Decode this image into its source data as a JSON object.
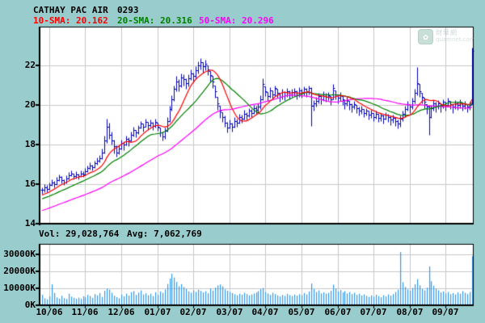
{
  "header": {
    "title": "CATHAY PAC AIR",
    "code": "0293"
  },
  "legend": [
    {
      "text": "10-SMA: 20.162",
      "color": "#ff0000"
    },
    {
      "text": "20-SMA: 20.316",
      "color": "#008000"
    },
    {
      "text": "50-SMA: 20.296",
      "color": "#ff00ff"
    }
  ],
  "volume_header": {
    "vol": "Vol: 29,028,764",
    "avg": "Avg: 7,062,769"
  },
  "watermark": {
    "name": "財華網",
    "domain": "quamnet.com"
  },
  "chart_data": {
    "type": "ohlc_bars_with_volume",
    "title": "CATHAY PAC AIR 0293 daily price with 10/20/50-day SMA and volume",
    "x_axis": {
      "labels": [
        "10/06",
        "11/06",
        "12/06",
        "01/07",
        "02/07",
        "03/07",
        "04/07",
        "05/07",
        "06/07",
        "07/07",
        "08/07",
        "09/07"
      ]
    },
    "price_axis": {
      "ticks": [
        {
          "label": "22",
          "value": 22
        },
        {
          "label": "20",
          "value": 20
        },
        {
          "label": "18",
          "value": 18
        },
        {
          "label": "16",
          "value": 16
        },
        {
          "label": "14",
          "value": 14
        }
      ],
      "ylim": [
        14,
        23.96
      ]
    },
    "volume_axis": {
      "ticks": [
        {
          "label": "30000K",
          "value_k": 30000
        },
        {
          "label": "20000K",
          "value_k": 20000
        },
        {
          "label": "10000K",
          "value_k": 10000
        },
        {
          "label": "0K",
          "value_k": 0
        }
      ],
      "ylim_k": [
        0,
        36500
      ]
    },
    "sma_series": [
      {
        "name": "10-SMA",
        "period": 10,
        "last": 20.162,
        "color": "#ff0000"
      },
      {
        "name": "20-SMA",
        "period": 20,
        "last": 20.316,
        "color": "#008000"
      },
      {
        "name": "50-SMA",
        "period": 50,
        "last": 20.296,
        "color": "#ff00ff"
      }
    ],
    "last_volume": 29028764,
    "avg_volume": 7062769,
    "colors": {
      "background": "#99cccc",
      "pane": "#ffffff",
      "grid": "#c8c8c8",
      "frame": "#000000",
      "ohlc_bar": "#0000bb",
      "volume_bar": "#3399ee"
    },
    "bars_hlc": [
      [
        15.85,
        15.5,
        15.7
      ],
      [
        16.0,
        15.6,
        15.85
      ],
      [
        15.95,
        15.6,
        15.75
      ],
      [
        16.1,
        15.7,
        15.95
      ],
      [
        16.25,
        15.9,
        16.1
      ],
      [
        16.15,
        15.85,
        16.0
      ],
      [
        16.35,
        15.95,
        16.2
      ],
      [
        16.5,
        16.15,
        16.35
      ],
      [
        16.4,
        16.05,
        16.2
      ],
      [
        16.25,
        15.95,
        16.1
      ],
      [
        16.45,
        16.05,
        16.3
      ],
      [
        16.6,
        16.25,
        16.45
      ],
      [
        16.7,
        16.4,
        16.55
      ],
      [
        16.55,
        16.25,
        16.4
      ],
      [
        16.65,
        16.3,
        16.5
      ],
      [
        16.55,
        16.25,
        16.4
      ],
      [
        16.7,
        16.35,
        16.55
      ],
      [
        16.65,
        16.35,
        16.5
      ],
      [
        16.8,
        16.45,
        16.65
      ],
      [
        16.95,
        16.6,
        16.8
      ],
      [
        17.1,
        16.75,
        16.95
      ],
      [
        17.0,
        16.7,
        16.85
      ],
      [
        17.2,
        16.8,
        17.05
      ],
      [
        17.35,
        17.0,
        17.2
      ],
      [
        17.45,
        17.1,
        17.3
      ],
      [
        17.8,
        17.25,
        17.6
      ],
      [
        18.45,
        17.55,
        18.2
      ],
      [
        19.3,
        18.1,
        18.9
      ],
      [
        19.1,
        18.3,
        18.5
      ],
      [
        18.65,
        18.0,
        18.2
      ],
      [
        18.25,
        17.55,
        17.9
      ],
      [
        17.95,
        17.4,
        17.6
      ],
      [
        18.0,
        17.5,
        17.8
      ],
      [
        18.25,
        17.75,
        18.1
      ],
      [
        18.15,
        17.7,
        18.0
      ],
      [
        18.45,
        17.95,
        18.3
      ],
      [
        18.35,
        17.9,
        18.2
      ],
      [
        18.65,
        18.15,
        18.5
      ],
      [
        18.9,
        18.4,
        18.75
      ],
      [
        18.75,
        18.35,
        18.6
      ],
      [
        19.0,
        18.55,
        18.85
      ],
      [
        19.2,
        18.8,
        19.05
      ],
      [
        19.05,
        18.65,
        18.9
      ],
      [
        19.3,
        18.9,
        19.15
      ],
      [
        19.15,
        18.75,
        19.0
      ],
      [
        19.25,
        18.9,
        19.1
      ],
      [
        19.15,
        18.75,
        18.95
      ],
      [
        19.3,
        18.85,
        19.15
      ],
      [
        19.1,
        18.7,
        18.9
      ],
      [
        18.85,
        18.4,
        18.6
      ],
      [
        18.65,
        18.2,
        18.4
      ],
      [
        18.85,
        18.3,
        18.7
      ],
      [
        19.4,
        18.65,
        19.2
      ],
      [
        19.95,
        19.15,
        19.8
      ],
      [
        20.5,
        19.7,
        20.3
      ],
      [
        21.0,
        20.2,
        20.8
      ],
      [
        21.45,
        20.7,
        21.2
      ],
      [
        21.3,
        20.7,
        21.0
      ],
      [
        21.6,
        20.9,
        21.4
      ],
      [
        21.55,
        21.0,
        21.3
      ],
      [
        21.35,
        20.8,
        21.1
      ],
      [
        21.55,
        20.95,
        21.35
      ],
      [
        21.8,
        21.25,
        21.6
      ],
      [
        21.65,
        21.15,
        21.45
      ],
      [
        21.95,
        21.35,
        21.75
      ],
      [
        22.2,
        21.6,
        22.0
      ],
      [
        22.35,
        21.8,
        22.15
      ],
      [
        22.15,
        21.65,
        21.95
      ],
      [
        22.3,
        21.75,
        22.1
      ],
      [
        22.0,
        21.5,
        21.8
      ],
      [
        21.7,
        21.2,
        21.5
      ],
      [
        21.45,
        20.85,
        21.2
      ],
      [
        21.0,
        20.35,
        20.7
      ],
      [
        20.4,
        19.75,
        20.1
      ],
      [
        19.95,
        19.35,
        19.7
      ],
      [
        19.65,
        19.15,
        19.4
      ],
      [
        19.45,
        18.9,
        19.1
      ],
      [
        19.15,
        18.6,
        18.85
      ],
      [
        19.25,
        18.8,
        19.05
      ],
      [
        19.1,
        18.65,
        18.9
      ],
      [
        19.4,
        18.85,
        19.2
      ],
      [
        19.3,
        18.9,
        19.1
      ],
      [
        19.55,
        19.05,
        19.4
      ],
      [
        19.5,
        19.1,
        19.3
      ],
      [
        19.75,
        19.25,
        19.55
      ],
      [
        19.65,
        19.25,
        19.45
      ],
      [
        19.85,
        19.4,
        19.7
      ],
      [
        19.8,
        19.4,
        19.6
      ],
      [
        20.0,
        19.55,
        19.85
      ],
      [
        19.95,
        19.55,
        19.75
      ],
      [
        20.1,
        19.6,
        19.9
      ],
      [
        20.5,
        19.8,
        20.3
      ],
      [
        21.35,
        20.25,
        21.05
      ],
      [
        20.95,
        20.45,
        20.7
      ],
      [
        20.65,
        20.2,
        20.45
      ],
      [
        20.9,
        20.35,
        20.75
      ],
      [
        20.75,
        20.3,
        20.55
      ],
      [
        21.0,
        20.45,
        20.85
      ],
      [
        20.8,
        20.35,
        20.6
      ],
      [
        20.6,
        20.15,
        20.4
      ],
      [
        20.8,
        20.3,
        20.65
      ],
      [
        20.7,
        20.25,
        20.5
      ],
      [
        20.85,
        20.4,
        20.7
      ],
      [
        20.75,
        20.3,
        20.55
      ],
      [
        20.8,
        20.4,
        20.65
      ],
      [
        20.85,
        20.45,
        20.7
      ],
      [
        20.75,
        20.3,
        20.5
      ],
      [
        20.9,
        20.4,
        20.75
      ],
      [
        20.8,
        20.35,
        20.6
      ],
      [
        20.95,
        20.5,
        20.8
      ],
      [
        20.85,
        20.4,
        20.65
      ],
      [
        21.0,
        20.55,
        20.85
      ],
      [
        20.9,
        18.95,
        19.95
      ],
      [
        20.25,
        19.7,
        20.1
      ],
      [
        20.4,
        19.9,
        20.2
      ],
      [
        20.6,
        20.1,
        20.45
      ],
      [
        20.5,
        20.05,
        20.3
      ],
      [
        20.7,
        20.2,
        20.55
      ],
      [
        20.6,
        20.15,
        20.4
      ],
      [
        20.65,
        20.25,
        20.5
      ],
      [
        20.45,
        20.0,
        20.3
      ],
      [
        21.05,
        20.3,
        20.85
      ],
      [
        20.75,
        20.3,
        20.55
      ],
      [
        20.55,
        20.1,
        20.35
      ],
      [
        20.65,
        20.2,
        20.5
      ],
      [
        20.45,
        20.0,
        20.3
      ],
      [
        20.25,
        19.8,
        20.1
      ],
      [
        20.4,
        19.95,
        20.25
      ],
      [
        20.2,
        19.75,
        20.05
      ],
      [
        20.1,
        19.65,
        19.9
      ],
      [
        20.2,
        19.8,
        20.05
      ],
      [
        20.0,
        19.6,
        19.85
      ],
      [
        19.9,
        19.45,
        19.7
      ],
      [
        19.95,
        19.55,
        19.8
      ],
      [
        19.8,
        19.4,
        19.6
      ],
      [
        19.85,
        19.45,
        19.7
      ],
      [
        19.7,
        19.25,
        19.5
      ],
      [
        19.75,
        19.35,
        19.6
      ],
      [
        19.6,
        19.2,
        19.4
      ],
      [
        19.7,
        19.3,
        19.55
      ],
      [
        19.55,
        19.15,
        19.35
      ],
      [
        19.6,
        19.2,
        19.45
      ],
      [
        19.5,
        19.05,
        19.3
      ],
      [
        19.65,
        19.25,
        19.5
      ],
      [
        19.55,
        19.15,
        19.4
      ],
      [
        19.45,
        19.0,
        19.25
      ],
      [
        19.5,
        19.1,
        19.35
      ],
      [
        19.4,
        18.95,
        19.2
      ],
      [
        19.25,
        18.8,
        19.05
      ],
      [
        19.45,
        18.9,
        19.3
      ],
      [
        19.7,
        19.2,
        19.55
      ],
      [
        19.95,
        19.4,
        19.8
      ],
      [
        20.2,
        19.7,
        20.05
      ],
      [
        20.05,
        19.6,
        19.9
      ],
      [
        20.35,
        19.8,
        20.2
      ],
      [
        20.8,
        20.1,
        20.6
      ],
      [
        21.9,
        20.5,
        21.1
      ],
      [
        21.05,
        20.4,
        20.7
      ],
      [
        20.6,
        20.1,
        20.4
      ],
      [
        20.35,
        19.85,
        20.15
      ],
      [
        20.05,
        19.55,
        19.9
      ],
      [
        20.0,
        18.5,
        19.4
      ],
      [
        20.0,
        19.35,
        19.85
      ],
      [
        20.25,
        19.7,
        20.1
      ],
      [
        20.15,
        19.65,
        19.95
      ],
      [
        20.25,
        19.8,
        20.1
      ],
      [
        20.1,
        19.65,
        19.95
      ],
      [
        20.3,
        19.85,
        20.15
      ],
      [
        20.15,
        19.7,
        20.0
      ],
      [
        20.35,
        19.9,
        20.2
      ],
      [
        20.2,
        19.8,
        20.05
      ],
      [
        20.05,
        19.6,
        19.9
      ],
      [
        20.25,
        19.8,
        20.1
      ],
      [
        20.15,
        19.75,
        20.0
      ],
      [
        20.3,
        19.85,
        20.15
      ],
      [
        20.1,
        19.7,
        19.95
      ],
      [
        20.2,
        19.8,
        20.05
      ],
      [
        20.05,
        19.65,
        19.9
      ],
      [
        20.15,
        19.75,
        20.0
      ],
      [
        22.9,
        20.05,
        22.75
      ]
    ],
    "volumes_k": [
      6200,
      4100,
      3500,
      5200,
      12400,
      7300,
      4600,
      3900,
      5600,
      4200,
      3700,
      6800,
      5100,
      4400,
      3800,
      4500,
      3800,
      5300,
      4700,
      6100,
      5500,
      4300,
      6600,
      5800,
      7200,
      4900,
      8600,
      9800,
      9200,
      7400,
      5600,
      4800,
      4100,
      6300,
      5200,
      6900,
      5700,
      7800,
      8400,
      6100,
      7500,
      8800,
      6400,
      7100,
      5900,
      6800,
      5400,
      7700,
      6200,
      8100,
      7300,
      9400,
      12600,
      15800,
      18600,
      16400,
      13800,
      11200,
      12500,
      10800,
      9600,
      8200,
      7400,
      8800,
      7900,
      9200,
      8500,
      7600,
      8300,
      7100,
      9800,
      8700,
      10400,
      11800,
      12300,
      11200,
      9400,
      8600,
      7800,
      7200,
      6500,
      5900,
      6800,
      6200,
      7400,
      6600,
      5800,
      6400,
      7000,
      7600,
      8400,
      9600,
      10200,
      7800,
      6900,
      6200,
      7400,
      6600,
      5800,
      5200,
      6100,
      5500,
      6800,
      6000,
      5400,
      6300,
      5700,
      6500,
      5900,
      7200,
      6400,
      8100,
      12800,
      9600,
      7800,
      8800,
      7000,
      7700,
      6900,
      7300,
      8600,
      12200,
      9800,
      8200,
      9000,
      7600,
      8400,
      7000,
      7800,
      6600,
      7400,
      6200,
      6800,
      5800,
      6400,
      5600,
      4900,
      5800,
      5100,
      6200,
      5400,
      4700,
      5900,
      5200,
      6400,
      5700,
      6600,
      7800,
      9200,
      31500,
      13600,
      10800,
      9400,
      8600,
      10200,
      12400,
      15500,
      11800,
      9600,
      8800,
      10400,
      23000,
      14200,
      11600,
      9800,
      8800,
      7600,
      8200,
      7000,
      7800,
      6600,
      7200,
      6400,
      7600,
      6800,
      8400,
      7400,
      6600,
      7800,
      29029
    ],
    "sma_seed_closes": [
      13.6,
      13.65,
      13.72,
      13.68,
      13.8,
      13.85,
      13.78,
      13.9,
      13.95,
      14.05,
      14.0,
      14.1,
      14.18,
      14.12,
      14.25,
      14.3,
      14.22,
      14.35,
      14.42,
      14.38,
      14.5,
      14.45,
      14.55,
      14.62,
      14.58,
      14.7,
      14.65,
      14.75,
      14.82,
      14.78,
      14.9,
      14.85,
      14.95,
      15.02,
      14.98,
      15.1,
      15.05,
      15.15,
      15.1,
      15.2,
      15.28,
      15.22,
      15.35,
      15.3,
      15.4,
      15.35,
      15.45,
      15.52,
      15.48,
      15.6
    ]
  }
}
